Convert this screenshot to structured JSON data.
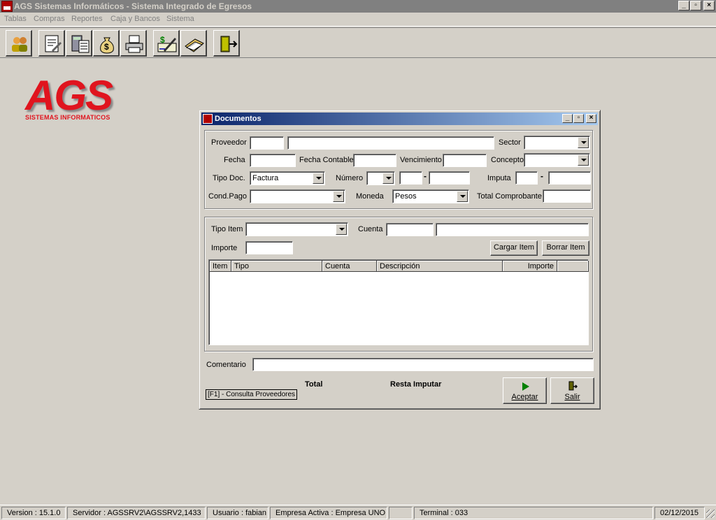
{
  "window": {
    "title": "AGS Sistemas Informáticos - Sistema Integrado de Egresos",
    "buttons": {
      "minimize": "_",
      "maximize": "▫",
      "close": "×"
    }
  },
  "menu": [
    "Tablas",
    "Compras",
    "Reportes",
    "Caja y Bancos",
    "Sistema"
  ],
  "toolbar": {
    "icons": [
      "suppliers-icon",
      "documents-icon",
      "calculator-icon",
      "money-bag-icon",
      "printer-icon",
      "check-sign-icon",
      "bank-book-icon",
      "exit-door-icon"
    ]
  },
  "logo": {
    "main": "AGS",
    "sub": "SISTEMAS INFORMATICOS"
  },
  "dialog": {
    "title": "Documentos",
    "labels": {
      "proveedor": "Proveedor",
      "sector": "Sector",
      "fecha": "Fecha",
      "fecha_contable": "Fecha Contable",
      "vencimiento": "Vencimiento",
      "concepto": "Concepto",
      "tipo_doc": "Tipo Doc.",
      "numero": "Número",
      "imputa": "Imputa",
      "cond_pago": "Cond.Pago",
      "moneda": "Moneda",
      "total_comprobante": "Total Comprobante",
      "tipo_item": "Tipo Item",
      "cuenta": "Cuenta",
      "importe": "Importe",
      "comentario": "Comentario",
      "total": "Total",
      "resta_imputar": "Resta Imputar",
      "hint": "[F1] - Consulta Proveedores"
    },
    "values": {
      "tipo_doc": "Factura",
      "moneda": "Pesos"
    },
    "buttons": {
      "cargar_item": "Cargar Item",
      "borrar_item": "Borrar Item",
      "aceptar": "Aceptar",
      "salir": "Salir"
    },
    "grid_columns": [
      "Item",
      "Tipo",
      "Cuenta",
      "Descripción",
      "Importe"
    ],
    "dash": "-"
  },
  "status": {
    "version": "Version : 15.1.0",
    "servidor": "Servidor : AGSSRV2\\AGSSRV2,1433",
    "usuario": "Usuario : fabian",
    "empresa": "Empresa Activa : Empresa UNO",
    "terminal": "Terminal : 033",
    "fecha": "02/12/2015"
  }
}
